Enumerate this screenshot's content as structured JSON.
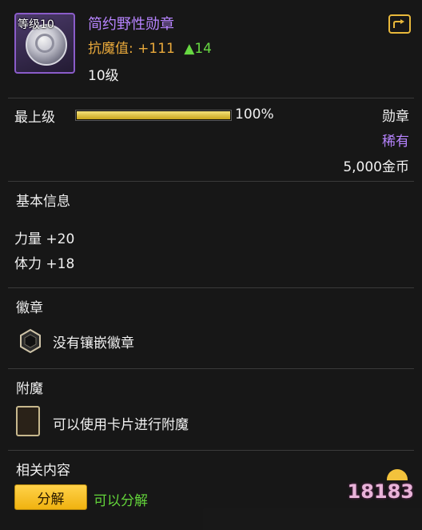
{
  "item": {
    "level_badge": "等级10",
    "name": "简约野性勋章",
    "stat_label": "抗魔值:",
    "stat_value": "+111",
    "stat_increase": "▲14",
    "level_text": "10级"
  },
  "upgrade": {
    "label": "最上级",
    "progress_percent": 100,
    "percent_text": "100%"
  },
  "meta": {
    "type": "勋章",
    "rarity": "稀有",
    "price": "5,000金币"
  },
  "basic_info": {
    "title": "基本信息",
    "attributes": [
      "力量 +20",
      "体力 +18"
    ]
  },
  "emblem": {
    "title": "徽章",
    "status": "没有镶嵌徽章"
  },
  "enchant": {
    "title": "附魔",
    "hint": "可以使用卡片进行附魔"
  },
  "related": {
    "title": "相关内容",
    "decompose_button": "分解",
    "decompose_status": "可以分解"
  },
  "watermark": "18183",
  "colors": {
    "epic_purple": "#b784ff",
    "stat_orange": "#e9a93b",
    "up_green": "#67d842",
    "button_yellow": "#f0b20f"
  }
}
